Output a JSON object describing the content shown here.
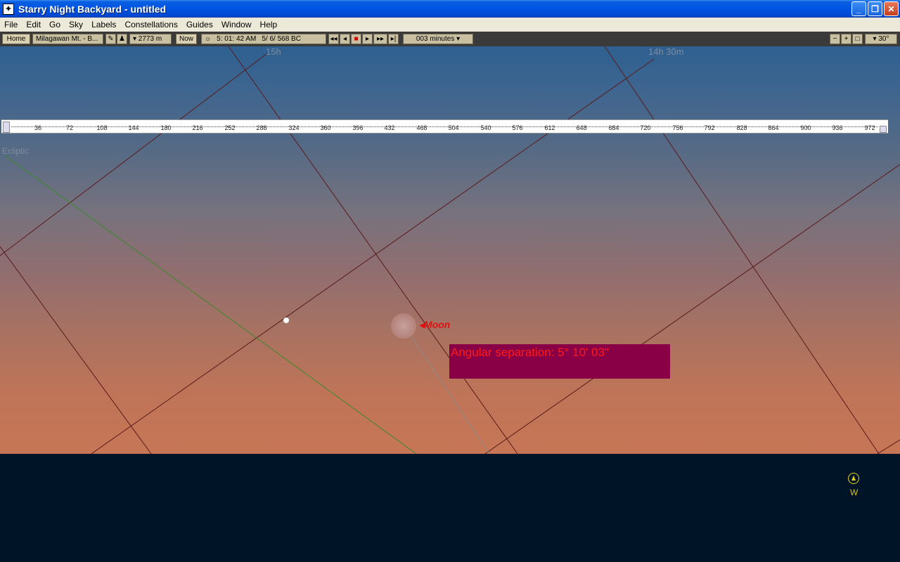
{
  "window": {
    "title": "Starry Night Backyard - untitled",
    "minimize": "_",
    "maximize": "❐",
    "close": "✕"
  },
  "menu": [
    "File",
    "Edit",
    "Go",
    "Sky",
    "Labels",
    "Constellations",
    "Guides",
    "Window",
    "Help"
  ],
  "toolbar": {
    "home": "Home",
    "location": "Milagawan Mt. - B...",
    "elevation": "▾ 2773 m",
    "now": "Now",
    "time": "5: 01: 42 AM",
    "date": "5/  6/  568 BC",
    "time_step": "003 minutes ▾",
    "zoom": "▾ 30°"
  },
  "ruler": {
    "ticks": [
      "36",
      "72",
      "108",
      "144",
      "180",
      "216",
      "252",
      "288",
      "324",
      "360",
      "396",
      "432",
      "468",
      "504",
      "540",
      "576",
      "612",
      "648",
      "684",
      "720",
      "756",
      "792",
      "828",
      "864",
      "900",
      "936",
      "972"
    ]
  },
  "sky": {
    "label_ra1": "15h",
    "label_ra2": "14h 30m",
    "label_ecliptic": "Ecliptic",
    "moon_label": "Moon",
    "angular_separation": "Angular separation: 5° 10' 03\"",
    "compass_direction": "W"
  },
  "colors": {
    "grid_line": "#5a1a1a",
    "ecliptic_line": "#3a8a2a",
    "angular_box": "#8a0046",
    "moon_label": "#e01010"
  }
}
